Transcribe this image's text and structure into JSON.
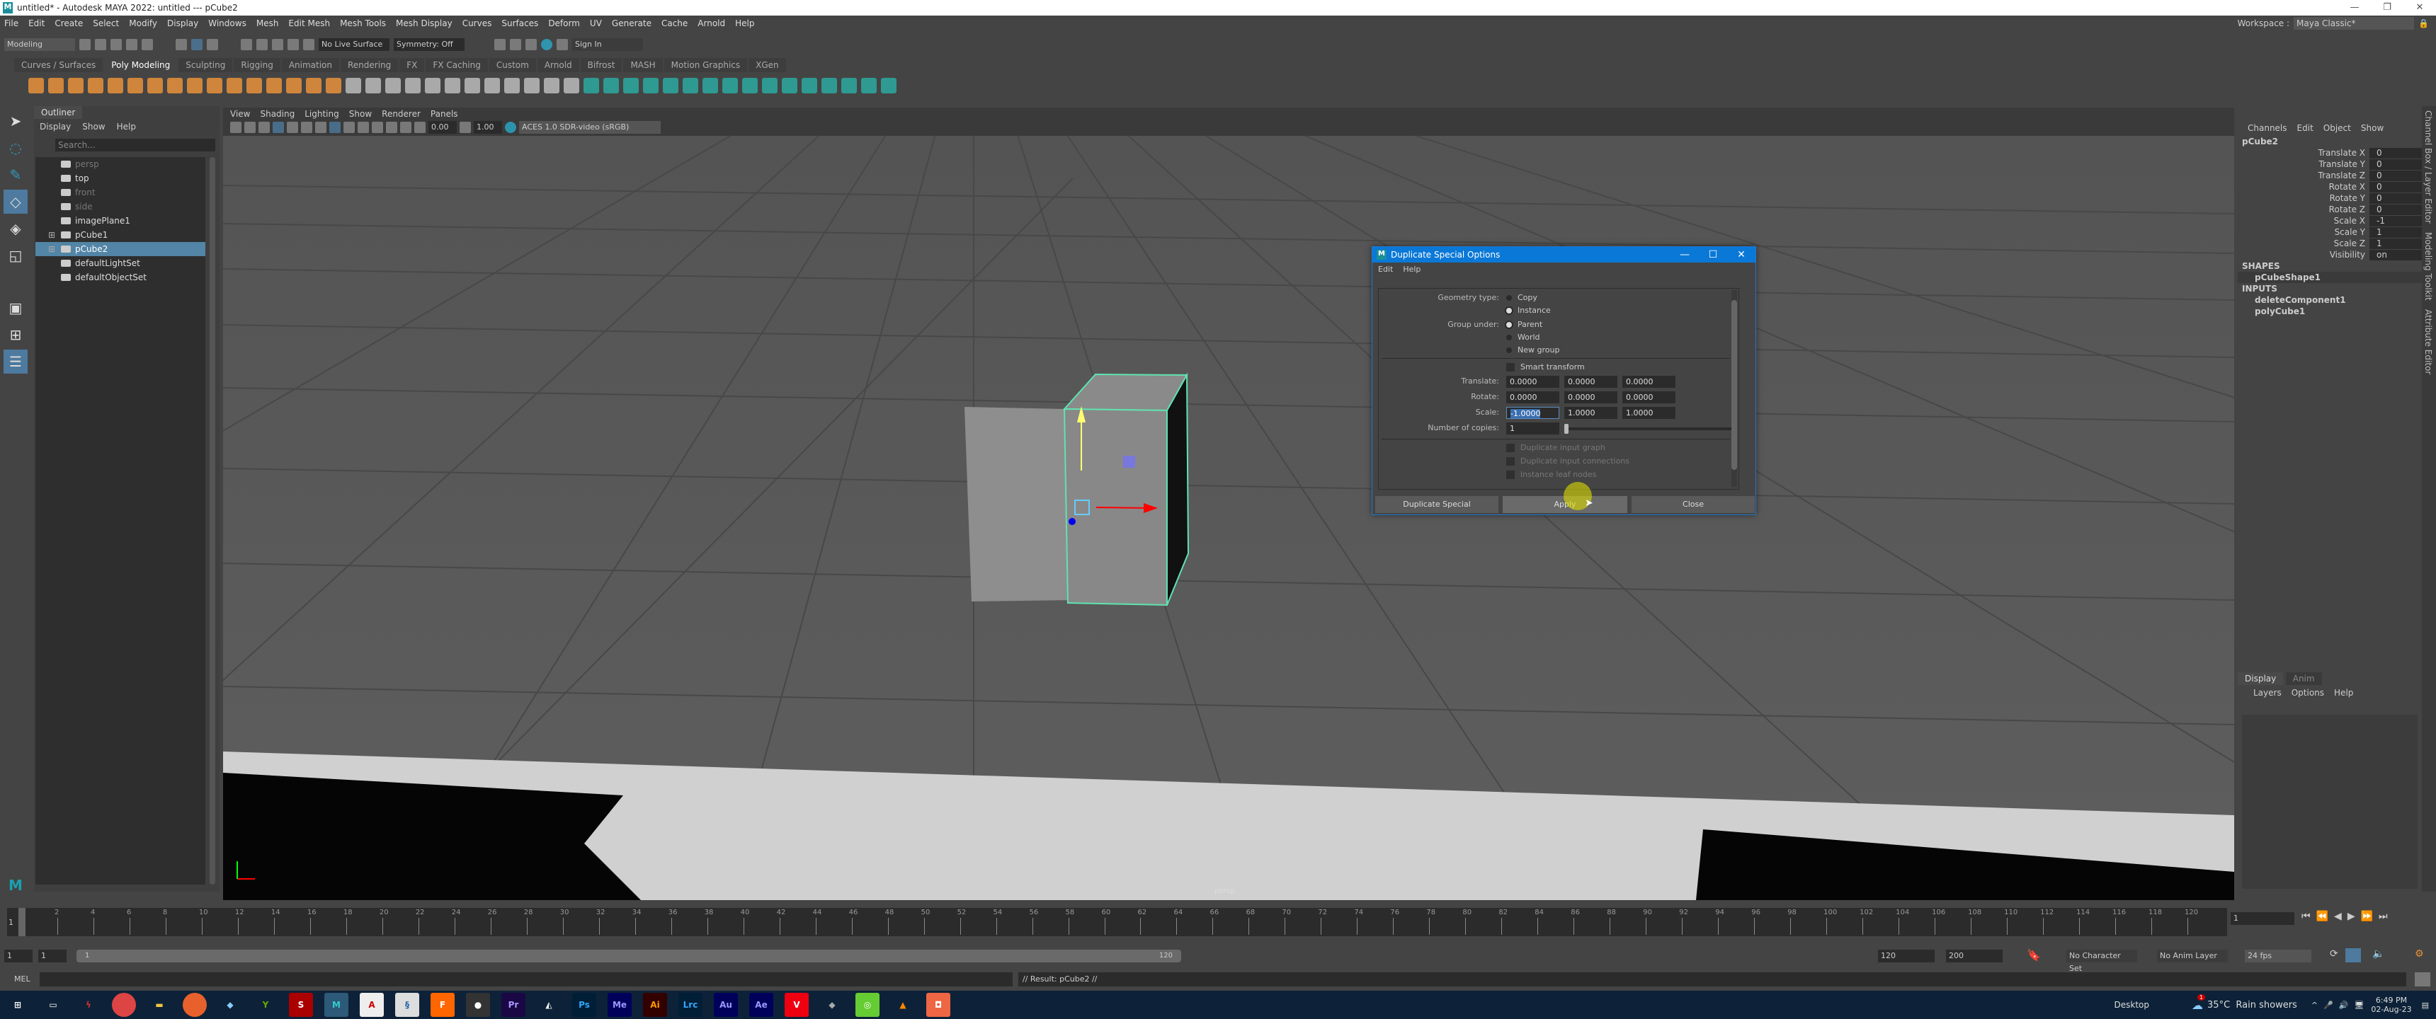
{
  "window": {
    "title": "untitled* - Autodesk MAYA 2022: untitled  ---  pCube2",
    "logo": "M"
  },
  "menubar": [
    "File",
    "Edit",
    "Create",
    "Select",
    "Modify",
    "Display",
    "Windows",
    "Mesh",
    "Edit Mesh",
    "Mesh Tools",
    "Mesh Display",
    "Curves",
    "Surfaces",
    "Deform",
    "UV",
    "Generate",
    "Cache",
    "Arnold",
    "Help"
  ],
  "workspace": {
    "label": "Workspace :",
    "value": "Maya Classic*"
  },
  "statusline": {
    "mode": "Modeling",
    "live_surface": "No Live Surface",
    "symmetry": "Symmetry: Off",
    "sign_in": "Sign In"
  },
  "shelf_tabs": [
    "Curves / Surfaces",
    "Poly Modeling",
    "Sculpting",
    "Rigging",
    "Animation",
    "Rendering",
    "FX",
    "FX Caching",
    "Custom",
    "Arnold",
    "Bifrost",
    "MASH",
    "Motion Graphics",
    "XGen"
  ],
  "shelf_active": "Poly Modeling",
  "shelf_icon_color": "#e8913a",
  "outliner": {
    "tab": "Outliner",
    "menu": [
      "Display",
      "Show",
      "Help"
    ],
    "search_placeholder": "Search...",
    "items": [
      {
        "label": "persp",
        "icon": "camera-icon",
        "dim": true
      },
      {
        "label": "top",
        "icon": "camera-icon"
      },
      {
        "label": "front",
        "icon": "camera-icon",
        "dim": true
      },
      {
        "label": "side",
        "icon": "camera-icon",
        "dim": true
      },
      {
        "label": "imagePlane1",
        "icon": "image-plane-icon"
      },
      {
        "label": "pCube1",
        "icon": "mesh-icon",
        "expand": true
      },
      {
        "label": "pCube2",
        "icon": "mesh-icon",
        "expand": true,
        "selected": true
      },
      {
        "label": "defaultLightSet",
        "icon": "set-icon"
      },
      {
        "label": "defaultObjectSet",
        "icon": "set-icon"
      }
    ]
  },
  "viewport": {
    "menu": [
      "View",
      "Shading",
      "Lighting",
      "Show",
      "Renderer",
      "Panels"
    ],
    "exposure": "0.00",
    "gamma": "1.00",
    "color_space": "ACES 1.0 SDR-video (sRGB)",
    "camera_label": "persp"
  },
  "dialog": {
    "title": "Duplicate Special Options",
    "menu": [
      "Edit",
      "Help"
    ],
    "geometry_type_label": "Geometry type:",
    "geometry_type_options": [
      "Copy",
      "Instance"
    ],
    "geometry_type_selected": "Instance",
    "group_under_label": "Group under:",
    "group_under_options": [
      "Parent",
      "World",
      "New group"
    ],
    "group_under_selected": "Parent",
    "smart_transform": "Smart transform",
    "translate_label": "Translate:",
    "translate": [
      "0.0000",
      "0.0000",
      "0.0000"
    ],
    "rotate_label": "Rotate:",
    "rotate": [
      "0.0000",
      "0.0000",
      "0.0000"
    ],
    "scale_label": "Scale:",
    "scale": [
      "-1.0000",
      "1.0000",
      "1.0000"
    ],
    "copies_label": "Number of copies:",
    "copies": "1",
    "disabled_options": [
      "Duplicate input graph",
      "Duplicate input connections",
      "Instance leaf nodes"
    ],
    "buttons": {
      "duplicate": "Duplicate Special",
      "apply": "Apply",
      "close": "Close"
    }
  },
  "channelbox": {
    "menu": [
      "Channels",
      "Edit",
      "Object",
      "Show"
    ],
    "object": "pCube2",
    "channels": [
      {
        "name": "Translate X",
        "value": "0"
      },
      {
        "name": "Translate Y",
        "value": "0"
      },
      {
        "name": "Translate Z",
        "value": "0"
      },
      {
        "name": "Rotate X",
        "value": "0"
      },
      {
        "name": "Rotate Y",
        "value": "0"
      },
      {
        "name": "Rotate Z",
        "value": "0"
      },
      {
        "name": "Scale X",
        "value": "-1"
      },
      {
        "name": "Scale Y",
        "value": "1"
      },
      {
        "name": "Scale Z",
        "value": "1"
      },
      {
        "name": "Visibility",
        "value": "on"
      }
    ],
    "shapes_label": "SHAPES",
    "shapes": [
      "pCubeShape1"
    ],
    "inputs_label": "INPUTS",
    "inputs": [
      "deleteComponent1",
      "polyCube1"
    ]
  },
  "side_tabs": [
    "Channel Box / Layer Editor",
    "Modeling Toolkit",
    "Attribute Editor"
  ],
  "layer_editor": {
    "tabs": [
      "Display",
      "Anim"
    ],
    "menu": [
      "Layers",
      "Options",
      "Help"
    ]
  },
  "timeline": {
    "ticks": [
      "2",
      "4",
      "6",
      "8",
      "10",
      "12",
      "14",
      "16",
      "18",
      "20",
      "22",
      "24",
      "26",
      "28",
      "30",
      "32",
      "34",
      "36",
      "38",
      "40",
      "42",
      "44",
      "46",
      "48",
      "50",
      "52",
      "54",
      "56",
      "58",
      "60",
      "62",
      "64",
      "66",
      "68",
      "70",
      "72",
      "74",
      "76",
      "78",
      "80",
      "82",
      "84",
      "86",
      "88",
      "90",
      "92",
      "94",
      "96",
      "98",
      "100",
      "102",
      "104",
      "106",
      "108",
      "110",
      "112",
      "114",
      "116",
      "118",
      "120"
    ],
    "current": "1",
    "current_field": "1"
  },
  "range": {
    "start": "1",
    "anim_start": "1",
    "slider_start": "1",
    "slider_end": "120",
    "end": "120",
    "anim_end": "200",
    "character_set": "No Character Set",
    "anim_layer": "No Anim Layer",
    "fps": "24 fps"
  },
  "cmdline": {
    "lang": "MEL",
    "result": "// Result: pCube2 //"
  },
  "taskbar": {
    "apps": [
      "Chrome",
      "Explorer",
      "Firefox",
      "Edge",
      "Ps",
      "Me",
      "Ai",
      "Lrc",
      "Au",
      "Ae",
      "Pr",
      "M",
      "A"
    ],
    "desktop": "Desktop",
    "weather": "35°C  Rain showers",
    "time": "6:49 PM",
    "date": "02-Aug-23",
    "badge": "1"
  }
}
